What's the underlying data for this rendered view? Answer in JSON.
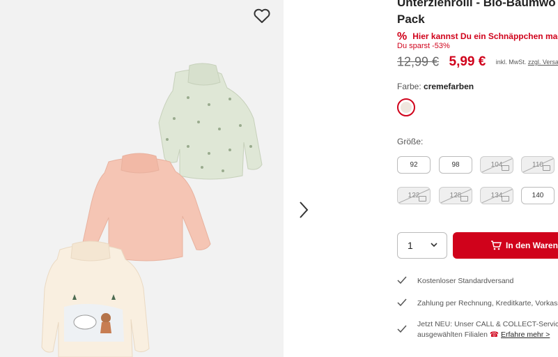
{
  "gallery": {
    "wishlist_icon": "heart-icon",
    "next_icon": "chevron-right-icon"
  },
  "product": {
    "title_line1": "Unterziehrolli - Bio-Baumwo",
    "title_line2": "Pack",
    "deal_icon": "%",
    "deal_text": "Hier kannst Du ein Schnäppchen mac",
    "saving": "Du sparst -53%",
    "old_price": "12,99 €",
    "new_price": "5,99 €",
    "tax_text": "inkl. MwSt.",
    "shipping_link": "zzgl. Versand"
  },
  "color": {
    "label": "Farbe:",
    "value": "cremefarben",
    "swatch_color": "#efe6de"
  },
  "size": {
    "label": "Größe:",
    "options": [
      {
        "label": "92",
        "available": true
      },
      {
        "label": "98",
        "available": true
      },
      {
        "label": "104",
        "available": false
      },
      {
        "label": "110",
        "available": false
      },
      {
        "label": "122",
        "available": false
      },
      {
        "label": "128",
        "available": false
      },
      {
        "label": "134",
        "available": false
      },
      {
        "label": "140",
        "available": true
      }
    ]
  },
  "cart": {
    "quantity": "1",
    "button_label": "In den Warenk"
  },
  "features": [
    {
      "text": "Kostenloser Standardversand"
    },
    {
      "text": "Zahlung per Rechnung, Kreditkarte, Vorkass"
    },
    {
      "line1": "Jetzt NEU: Unser CALL & COLLECT-Service",
      "line2": "ausgewählten Filialen",
      "link": "Erfahre mehr >"
    }
  ],
  "colors": {
    "accent": "#d0021b",
    "gallery_bg": "#f2f2f2"
  }
}
